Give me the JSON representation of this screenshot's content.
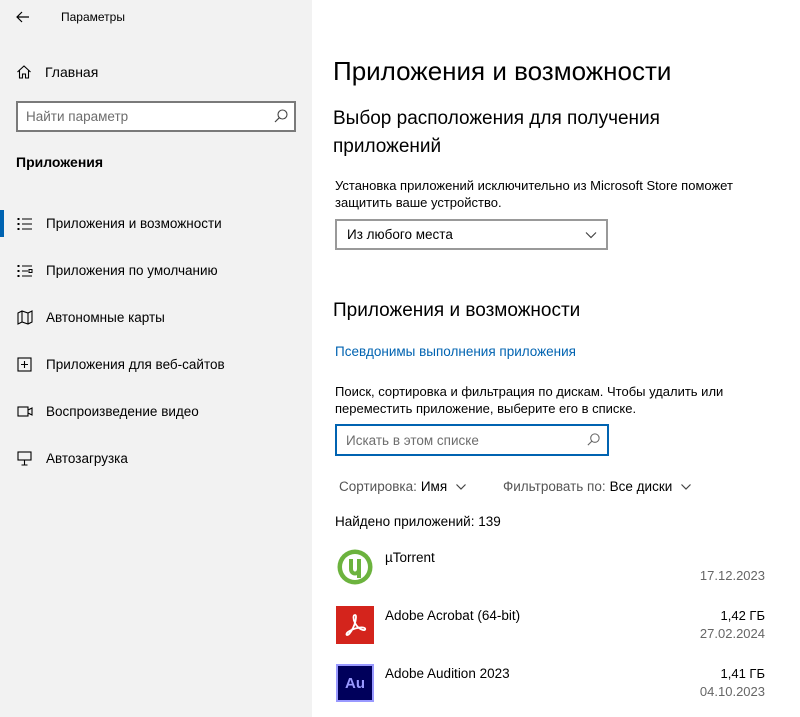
{
  "window": {
    "title": "Параметры"
  },
  "sidebar": {
    "home_label": "Главная",
    "search_placeholder": "Найти параметр",
    "section_title": "Приложения",
    "items": [
      {
        "label": "Приложения и возможности",
        "icon": "apps-list-icon",
        "active": true
      },
      {
        "label": "Приложения по умолчанию",
        "icon": "default-apps-icon",
        "active": false
      },
      {
        "label": "Автономные карты",
        "icon": "map-icon",
        "active": false
      },
      {
        "label": "Приложения для веб-сайтов",
        "icon": "web-apps-icon",
        "active": false
      },
      {
        "label": "Воспроизведение видео",
        "icon": "video-icon",
        "active": false
      },
      {
        "label": "Автозагрузка",
        "icon": "startup-icon",
        "active": false
      }
    ]
  },
  "main": {
    "page_title": "Приложения и возможности",
    "install_section": {
      "title": "Выбор расположения для получения приложений",
      "description": "Установка приложений исключительно из Microsoft Store поможет защитить ваше устройство.",
      "dropdown_value": "Из любого места"
    },
    "apps_section": {
      "title": "Приложения и возможности",
      "alias_link": "Псевдонимы выполнения приложения",
      "description": "Поиск, сортировка и фильтрация по дискам. Чтобы удалить или переместить приложение, выберите его в списке.",
      "search_placeholder": "Искать в этом списке",
      "sort_label": "Сортировка:",
      "sort_value": "Имя",
      "filter_label": "Фильтровать по:",
      "filter_value": "Все диски",
      "found_text": "Найдено приложений: 139",
      "apps": [
        {
          "name": "µTorrent",
          "size": "",
          "date": "17.12.2023",
          "icon": "utorrent-icon"
        },
        {
          "name": "Adobe Acrobat (64-bit)",
          "size": "1,42 ГБ",
          "date": "27.02.2024",
          "icon": "acrobat-icon"
        },
        {
          "name": "Adobe Audition 2023",
          "size": "1,41 ГБ",
          "date": "04.10.2023",
          "icon": "audition-icon",
          "icon_text": "Au"
        }
      ]
    }
  },
  "colors": {
    "accent": "#0063b1",
    "sidebar_bg": "#f2f2f2",
    "utorrent": "#6cb33e",
    "acrobat": "#d4241c",
    "audition_bg": "#00005b",
    "audition_text": "#9999ff"
  }
}
